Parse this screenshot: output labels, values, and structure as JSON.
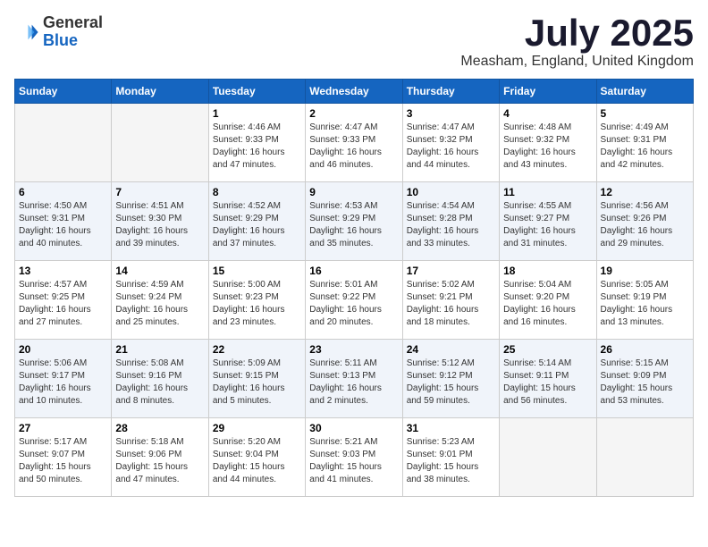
{
  "header": {
    "logo_general": "General",
    "logo_blue": "Blue",
    "title": "July 2025",
    "location": "Measham, England, United Kingdom"
  },
  "days_of_week": [
    "Sunday",
    "Monday",
    "Tuesday",
    "Wednesday",
    "Thursday",
    "Friday",
    "Saturday"
  ],
  "weeks": [
    [
      {
        "day": "",
        "empty": true
      },
      {
        "day": "",
        "empty": true
      },
      {
        "day": "1",
        "detail": "Sunrise: 4:46 AM\nSunset: 9:33 PM\nDaylight: 16 hours and 47 minutes."
      },
      {
        "day": "2",
        "detail": "Sunrise: 4:47 AM\nSunset: 9:33 PM\nDaylight: 16 hours and 46 minutes."
      },
      {
        "day": "3",
        "detail": "Sunrise: 4:47 AM\nSunset: 9:32 PM\nDaylight: 16 hours and 44 minutes."
      },
      {
        "day": "4",
        "detail": "Sunrise: 4:48 AM\nSunset: 9:32 PM\nDaylight: 16 hours and 43 minutes."
      },
      {
        "day": "5",
        "detail": "Sunrise: 4:49 AM\nSunset: 9:31 PM\nDaylight: 16 hours and 42 minutes."
      }
    ],
    [
      {
        "day": "6",
        "detail": "Sunrise: 4:50 AM\nSunset: 9:31 PM\nDaylight: 16 hours and 40 minutes."
      },
      {
        "day": "7",
        "detail": "Sunrise: 4:51 AM\nSunset: 9:30 PM\nDaylight: 16 hours and 39 minutes."
      },
      {
        "day": "8",
        "detail": "Sunrise: 4:52 AM\nSunset: 9:29 PM\nDaylight: 16 hours and 37 minutes."
      },
      {
        "day": "9",
        "detail": "Sunrise: 4:53 AM\nSunset: 9:29 PM\nDaylight: 16 hours and 35 minutes."
      },
      {
        "day": "10",
        "detail": "Sunrise: 4:54 AM\nSunset: 9:28 PM\nDaylight: 16 hours and 33 minutes."
      },
      {
        "day": "11",
        "detail": "Sunrise: 4:55 AM\nSunset: 9:27 PM\nDaylight: 16 hours and 31 minutes."
      },
      {
        "day": "12",
        "detail": "Sunrise: 4:56 AM\nSunset: 9:26 PM\nDaylight: 16 hours and 29 minutes."
      }
    ],
    [
      {
        "day": "13",
        "detail": "Sunrise: 4:57 AM\nSunset: 9:25 PM\nDaylight: 16 hours and 27 minutes."
      },
      {
        "day": "14",
        "detail": "Sunrise: 4:59 AM\nSunset: 9:24 PM\nDaylight: 16 hours and 25 minutes."
      },
      {
        "day": "15",
        "detail": "Sunrise: 5:00 AM\nSunset: 9:23 PM\nDaylight: 16 hours and 23 minutes."
      },
      {
        "day": "16",
        "detail": "Sunrise: 5:01 AM\nSunset: 9:22 PM\nDaylight: 16 hours and 20 minutes."
      },
      {
        "day": "17",
        "detail": "Sunrise: 5:02 AM\nSunset: 9:21 PM\nDaylight: 16 hours and 18 minutes."
      },
      {
        "day": "18",
        "detail": "Sunrise: 5:04 AM\nSunset: 9:20 PM\nDaylight: 16 hours and 16 minutes."
      },
      {
        "day": "19",
        "detail": "Sunrise: 5:05 AM\nSunset: 9:19 PM\nDaylight: 16 hours and 13 minutes."
      }
    ],
    [
      {
        "day": "20",
        "detail": "Sunrise: 5:06 AM\nSunset: 9:17 PM\nDaylight: 16 hours and 10 minutes."
      },
      {
        "day": "21",
        "detail": "Sunrise: 5:08 AM\nSunset: 9:16 PM\nDaylight: 16 hours and 8 minutes."
      },
      {
        "day": "22",
        "detail": "Sunrise: 5:09 AM\nSunset: 9:15 PM\nDaylight: 16 hours and 5 minutes."
      },
      {
        "day": "23",
        "detail": "Sunrise: 5:11 AM\nSunset: 9:13 PM\nDaylight: 16 hours and 2 minutes."
      },
      {
        "day": "24",
        "detail": "Sunrise: 5:12 AM\nSunset: 9:12 PM\nDaylight: 15 hours and 59 minutes."
      },
      {
        "day": "25",
        "detail": "Sunrise: 5:14 AM\nSunset: 9:11 PM\nDaylight: 15 hours and 56 minutes."
      },
      {
        "day": "26",
        "detail": "Sunrise: 5:15 AM\nSunset: 9:09 PM\nDaylight: 15 hours and 53 minutes."
      }
    ],
    [
      {
        "day": "27",
        "detail": "Sunrise: 5:17 AM\nSunset: 9:07 PM\nDaylight: 15 hours and 50 minutes."
      },
      {
        "day": "28",
        "detail": "Sunrise: 5:18 AM\nSunset: 9:06 PM\nDaylight: 15 hours and 47 minutes."
      },
      {
        "day": "29",
        "detail": "Sunrise: 5:20 AM\nSunset: 9:04 PM\nDaylight: 15 hours and 44 minutes."
      },
      {
        "day": "30",
        "detail": "Sunrise: 5:21 AM\nSunset: 9:03 PM\nDaylight: 15 hours and 41 minutes."
      },
      {
        "day": "31",
        "detail": "Sunrise: 5:23 AM\nSunset: 9:01 PM\nDaylight: 15 hours and 38 minutes."
      },
      {
        "day": "",
        "empty": true
      },
      {
        "day": "",
        "empty": true
      }
    ]
  ]
}
